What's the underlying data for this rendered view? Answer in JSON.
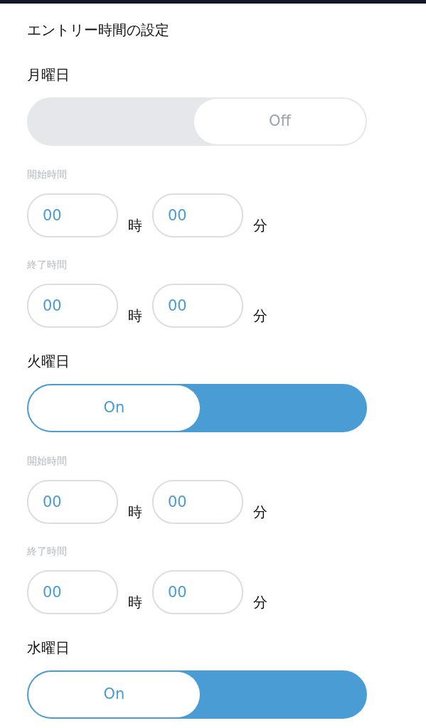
{
  "title": "エントリー時間の設定",
  "days": [
    {
      "name": "月曜日",
      "on": false,
      "toggle_label": "Off",
      "start": {
        "label": "開始時間",
        "hour": "00",
        "hour_unit": "時",
        "minute": "00",
        "minute_unit": "分"
      },
      "end": {
        "label": "終了時間",
        "hour": "00",
        "hour_unit": "時",
        "minute": "00",
        "minute_unit": "分"
      }
    },
    {
      "name": "火曜日",
      "on": true,
      "toggle_label": "On",
      "start": {
        "label": "開始時間",
        "hour": "00",
        "hour_unit": "時",
        "minute": "00",
        "minute_unit": "分"
      },
      "end": {
        "label": "終了時間",
        "hour": "00",
        "hour_unit": "時",
        "minute": "00",
        "minute_unit": "分"
      }
    },
    {
      "name": "水曜日",
      "on": true,
      "toggle_label": "On"
    }
  ]
}
